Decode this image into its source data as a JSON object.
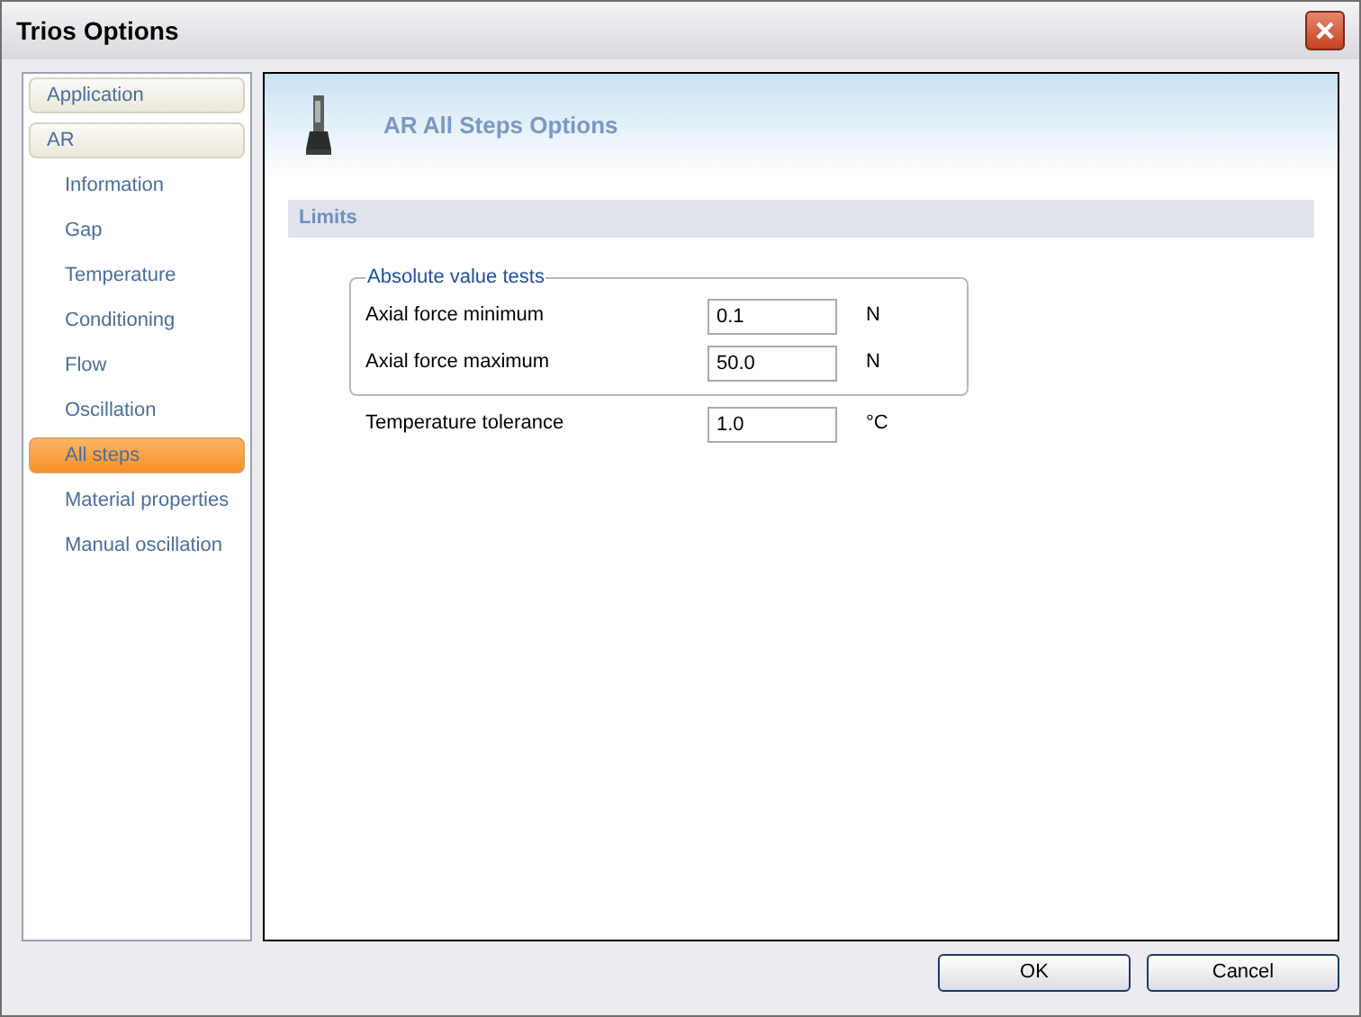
{
  "window": {
    "title": "Trios Options"
  },
  "sidebar": {
    "items": [
      {
        "label": "Application",
        "kind": "header",
        "selected": false
      },
      {
        "label": "AR",
        "kind": "header",
        "selected": false
      },
      {
        "label": "Information",
        "kind": "item",
        "selected": false
      },
      {
        "label": "Gap",
        "kind": "item",
        "selected": false
      },
      {
        "label": "Temperature",
        "kind": "item",
        "selected": false
      },
      {
        "label": "Conditioning",
        "kind": "item",
        "selected": false
      },
      {
        "label": "Flow",
        "kind": "item",
        "selected": false
      },
      {
        "label": "Oscillation",
        "kind": "item",
        "selected": false
      },
      {
        "label": "All steps",
        "kind": "item",
        "selected": true
      },
      {
        "label": "Material properties",
        "kind": "item",
        "selected": false
      },
      {
        "label": "Manual oscillation",
        "kind": "item",
        "selected": false
      }
    ]
  },
  "header": {
    "title": "AR All Steps Options"
  },
  "section": {
    "title": "Limits",
    "group": {
      "title": "Absolute value tests",
      "fields": [
        {
          "label": "Axial force minimum",
          "value": "0.1",
          "unit": "N"
        },
        {
          "label": "Axial force maximum",
          "value": "50.0",
          "unit": "N"
        }
      ]
    },
    "fields": [
      {
        "label": "Temperature tolerance",
        "value": "1.0",
        "unit": "°C"
      }
    ]
  },
  "buttons": [
    "OK",
    "Cancel"
  ]
}
